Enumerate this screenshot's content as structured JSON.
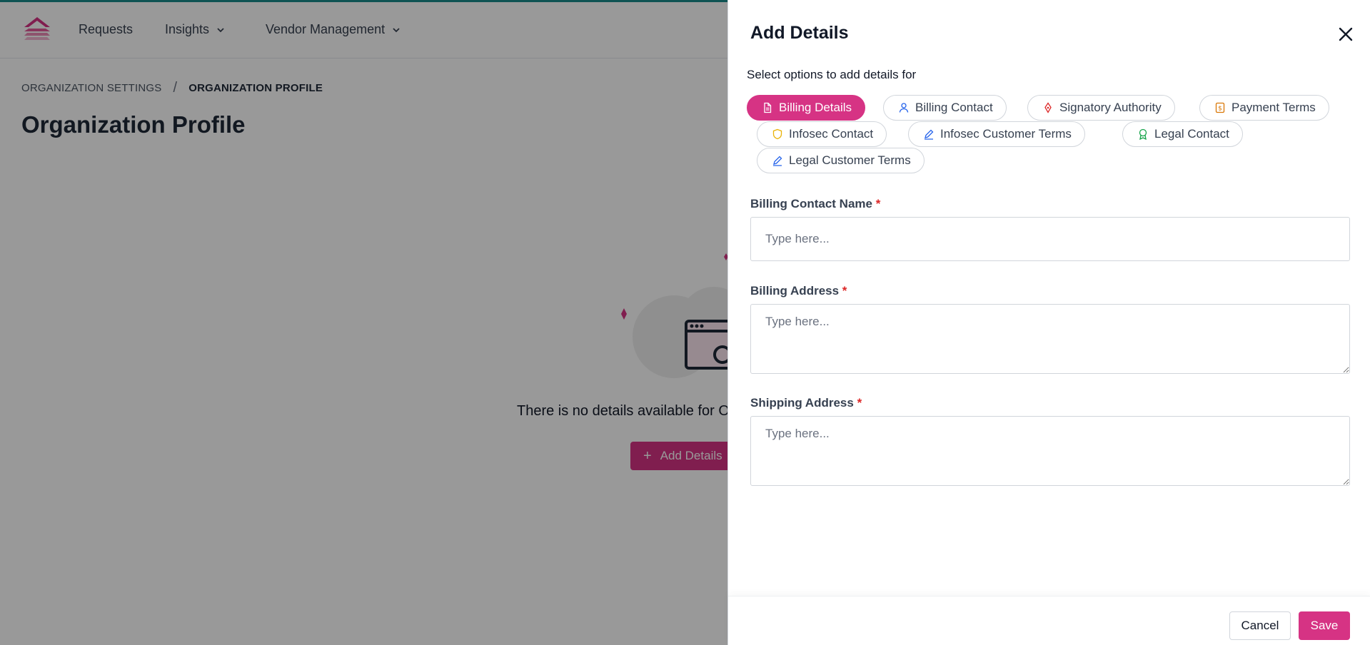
{
  "nav": {
    "items": [
      {
        "label": "Requests",
        "has_dropdown": false
      },
      {
        "label": "Insights",
        "has_dropdown": true
      },
      {
        "label": "Vendor Management",
        "has_dropdown": true
      }
    ]
  },
  "breadcrumb": {
    "parent": "ORGANIZATION SETTINGS",
    "separator": "/",
    "current": "ORGANIZATION PROFILE"
  },
  "page": {
    "title": "Organization Profile",
    "empty_text": "There is no details available for O",
    "add_button_label": "Add Details"
  },
  "drawer": {
    "title": "Add Details",
    "subtitle": "Select options to add details for",
    "chips": [
      {
        "label": "Billing Details",
        "icon": "document-icon",
        "active": true
      },
      {
        "label": "Billing Contact",
        "icon": "user-icon",
        "active": false
      },
      {
        "label": "Signatory Authority",
        "icon": "pen-nib-icon",
        "active": false
      },
      {
        "label": "Payment Terms",
        "icon": "dollar-document-icon",
        "active": false
      },
      {
        "label": "Infosec Contact",
        "icon": "shield-icon",
        "active": false
      },
      {
        "label": "Infosec Customer Terms",
        "icon": "pencil-icon",
        "active": false
      },
      {
        "label": "Legal Contact",
        "icon": "award-icon",
        "active": false
      },
      {
        "label": "Legal Customer Terms",
        "icon": "pencil-icon",
        "active": false
      }
    ],
    "fields": {
      "billing_contact_name": {
        "label": "Billing Contact Name",
        "required_mark": "*",
        "placeholder": "Type here..."
      },
      "billing_address": {
        "label": "Billing Address",
        "required_mark": "*",
        "placeholder": "Type here..."
      },
      "shipping_address": {
        "label": "Shipping Address",
        "required_mark": "*",
        "placeholder": "Type here..."
      }
    },
    "cancel_label": "Cancel",
    "save_label": "Save"
  },
  "colors": {
    "accent": "#d63384",
    "top_border": "#1a8a8a",
    "required": "#dc2626"
  }
}
